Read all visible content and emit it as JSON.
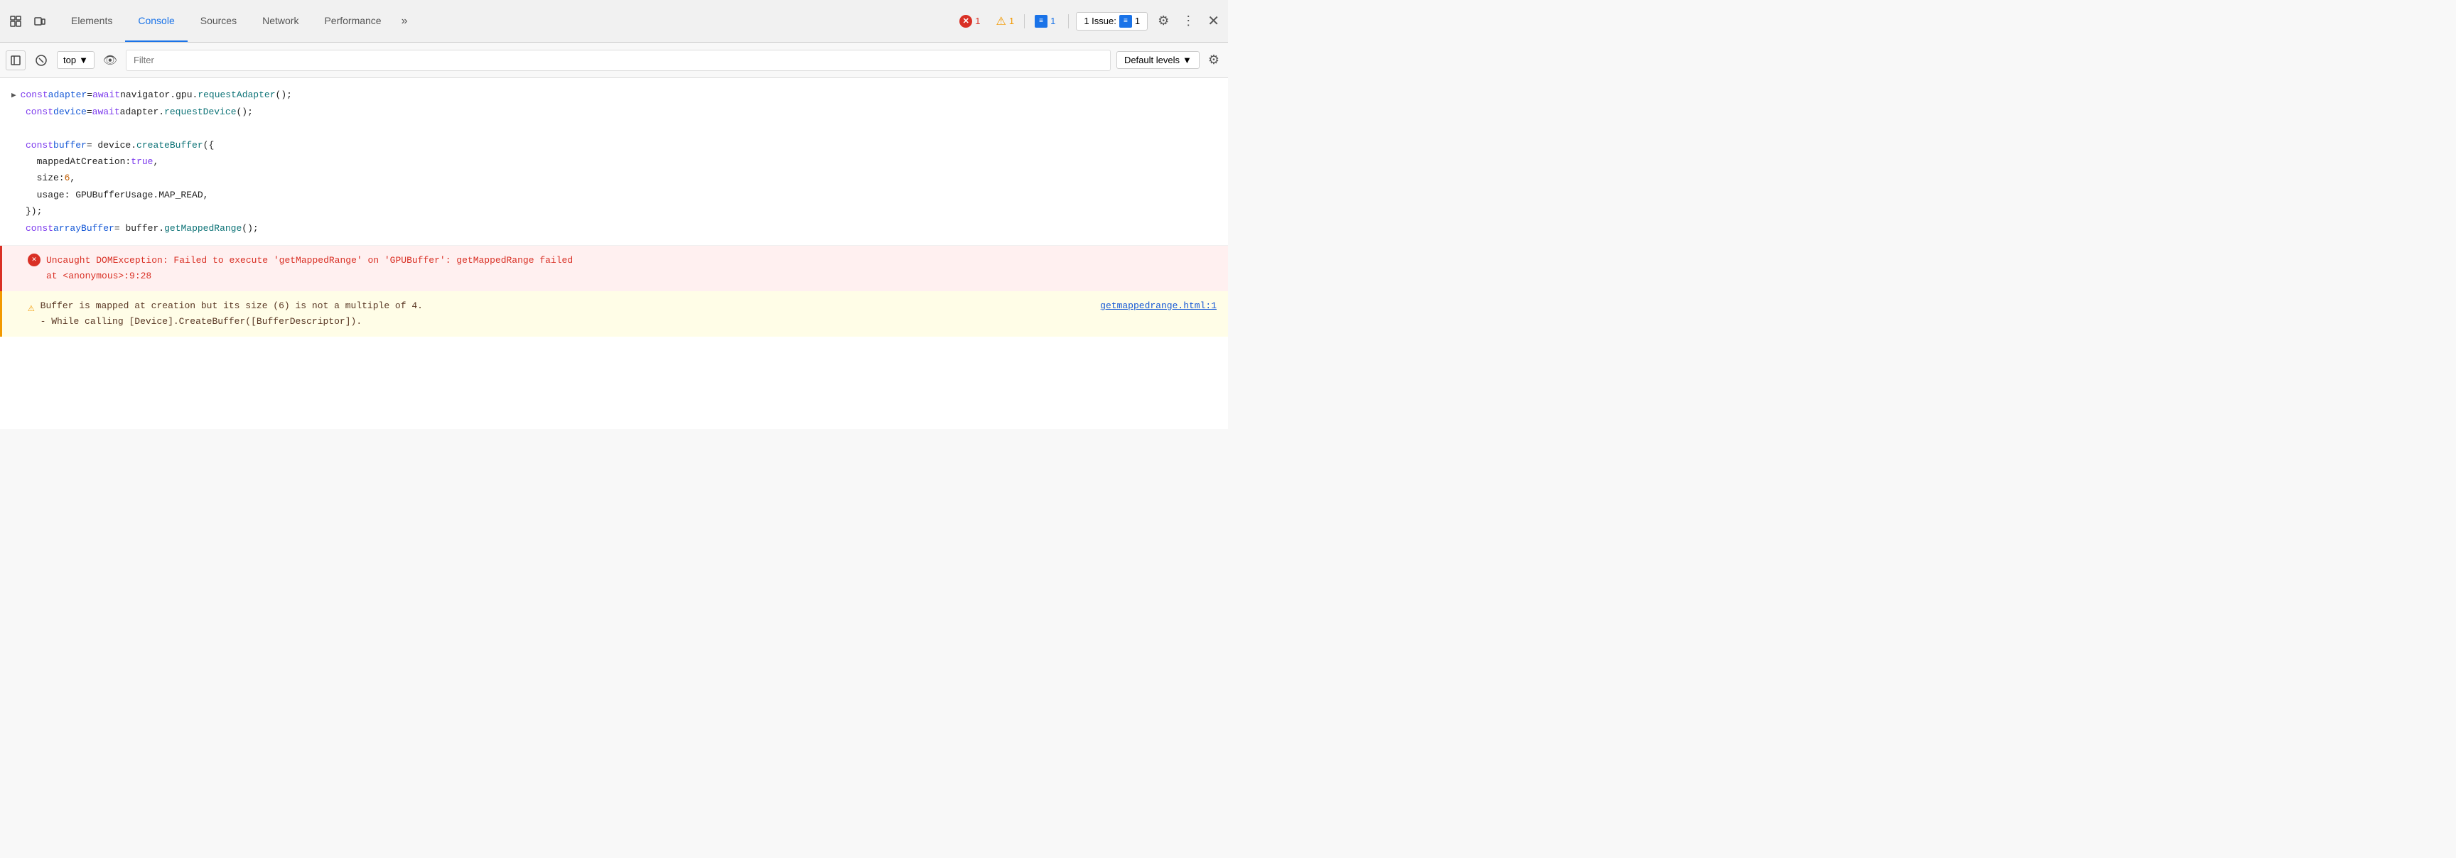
{
  "tabs": {
    "items": [
      {
        "label": "Elements",
        "active": false
      },
      {
        "label": "Console",
        "active": true
      },
      {
        "label": "Sources",
        "active": false
      },
      {
        "label": "Network",
        "active": false
      },
      {
        "label": "Performance",
        "active": false
      }
    ],
    "more_label": "»"
  },
  "toolbar_right": {
    "error_count": "1",
    "warning_count": "1",
    "info_count": "1",
    "issues_label": "1 Issue:",
    "issues_count": "1"
  },
  "second_toolbar": {
    "context": "top",
    "filter_placeholder": "Filter",
    "levels_label": "Default levels"
  },
  "console": {
    "code_lines": [
      {
        "text": "const adapter = await navigator.gpu.requestAdapter();"
      },
      {
        "text": "const device = await adapter.requestDevice();"
      },
      {
        "text": ""
      },
      {
        "text": "const buffer = device.createBuffer({"
      },
      {
        "text": "  mappedAtCreation: true,"
      },
      {
        "text": "  size: 6,"
      },
      {
        "text": "  usage: GPUBufferUsage.MAP_READ,"
      },
      {
        "text": "});"
      },
      {
        "text": "const arrayBuffer = buffer.getMappedRange();"
      }
    ],
    "error_message": "Uncaught DOMException: Failed to execute 'getMappedRange' on 'GPUBuffer': getMappedRange failed",
    "error_location": "    at <anonymous>:9:28",
    "warning_message": "Buffer is mapped at creation but its size (6) is not a multiple of 4.",
    "warning_sub": "  - While calling [Device].CreateBuffer([BufferDescriptor]).",
    "warning_link": "getmappedrange.html:1"
  }
}
